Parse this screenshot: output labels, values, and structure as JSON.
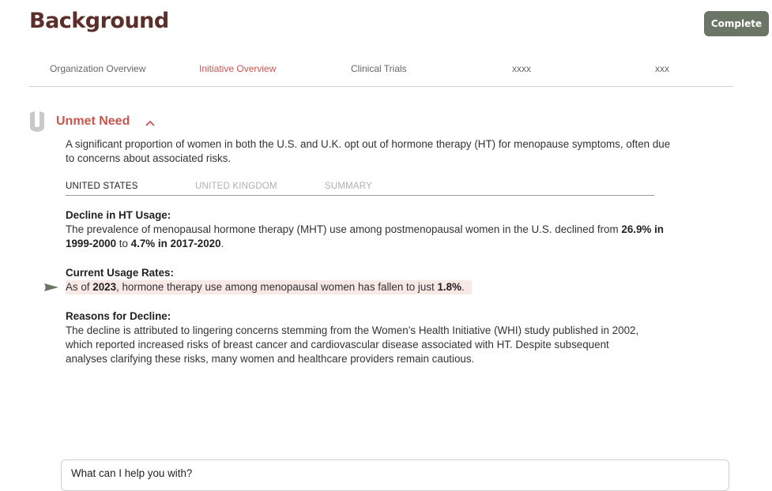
{
  "header": {
    "title": "Background",
    "complete_label": "Complete"
  },
  "tabs": [
    {
      "label": "Organization Overview",
      "active": false
    },
    {
      "label": "Initiative Overview",
      "active": true
    },
    {
      "label": "Clinical Trials",
      "active": false
    },
    {
      "label": "xxxx",
      "active": false
    },
    {
      "label": "xxx",
      "active": false
    }
  ],
  "section": {
    "title": "Unmet Need",
    "icon": "shield-bookmark-icon",
    "collapse_icon": "chevron-up-icon",
    "intro": "A significant proportion of women in both the U.S. and U.K. opt out of hormone therapy (HT) for menopause symptoms, often due to concerns about associated risks."
  },
  "subtabs": [
    {
      "label": "UNITED STATES",
      "active": true
    },
    {
      "label": "UNITED KINGDOM",
      "active": false
    },
    {
      "label": "SUMMARY",
      "active": false
    }
  ],
  "content": {
    "decline": {
      "heading": "Decline in HT Usage:",
      "text1": "The prevalence of menopausal hormone therapy (MHT) use among postmenopausal women in the U.S. declined from ",
      "bold1": "26.9% in 1999-2000",
      "text2": " to ",
      "bold2": "4.7% in 2017-2020",
      "text3": "."
    },
    "current": {
      "heading": "Current Usage Rates:",
      "text1": "As of ",
      "bold1": "2023",
      "text2": ", hormone therapy use among menopausal women has fallen to just ",
      "bold2": "1.8%",
      "text3": "."
    },
    "reasons": {
      "heading": "Reasons for Decline:",
      "text": "The decline is attributed to lingering concerns stemming from the Women’s Health Initiative (WHI) study published in 2002, which reported increased risks of breast cancer and cardiovascular disease associated with HT. Despite subsequent analyses clarifying these risks, many women and healthcare providers remain cautious."
    }
  },
  "chat": {
    "placeholder": "What can I help you with?"
  },
  "colors": {
    "title": "#5b2e2a",
    "accent": "#c7564e",
    "button": "#6b7565",
    "highlight": "#f9e9e6"
  }
}
